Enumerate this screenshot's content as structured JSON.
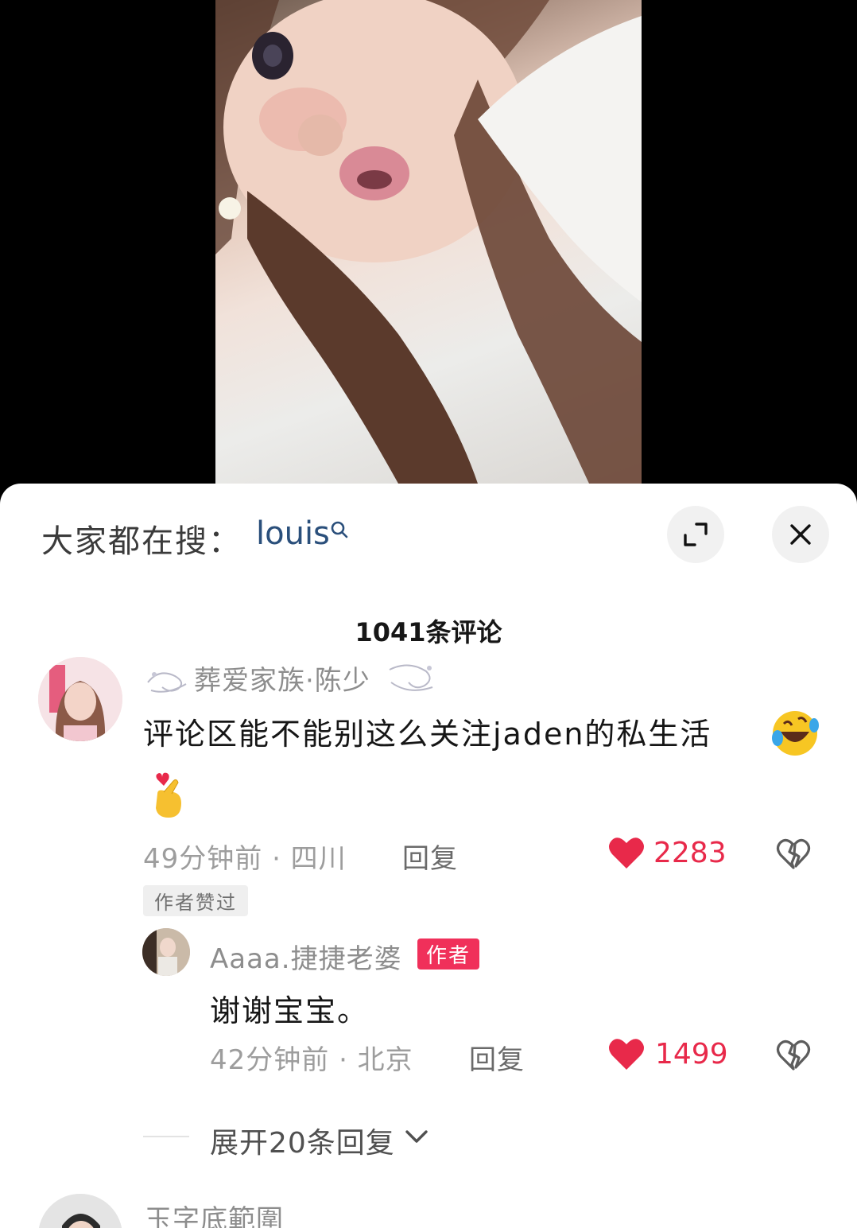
{
  "search": {
    "prompt": "大家都在搜：",
    "term": "louis"
  },
  "header": {
    "comment_count_label": "1041条评论"
  },
  "comments": [
    {
      "username": "葬爱家族·陈少",
      "text": "评论区能不能别这么关注jaden的私生活",
      "emojis": [
        "rolling-on-floor-laughing",
        "heart-hands"
      ],
      "meta": "49分钟前 · 四川",
      "reply_label": "回复",
      "likes": "2283",
      "badge": "作者赞过",
      "replies": [
        {
          "username": "Aaaa.捷捷老婆",
          "author_badge": "作者",
          "text": "谢谢宝宝。",
          "meta": "42分钟前 · 北京",
          "reply_label": "回复",
          "likes": "1499"
        }
      ],
      "expand_label": "展开20条回复"
    },
    {
      "username": "玉字底範圍"
    }
  ],
  "colors": {
    "accent_like": "#e8294a",
    "author_badge": "#f0305a",
    "search_term": "#2a4f7b"
  },
  "icons": {
    "search_term": "search-icon",
    "expand": "expand-icon",
    "close": "close-icon",
    "like": "heart-icon",
    "dislike": "broken-heart-icon",
    "expand_replies": "chevron-down-icon"
  }
}
